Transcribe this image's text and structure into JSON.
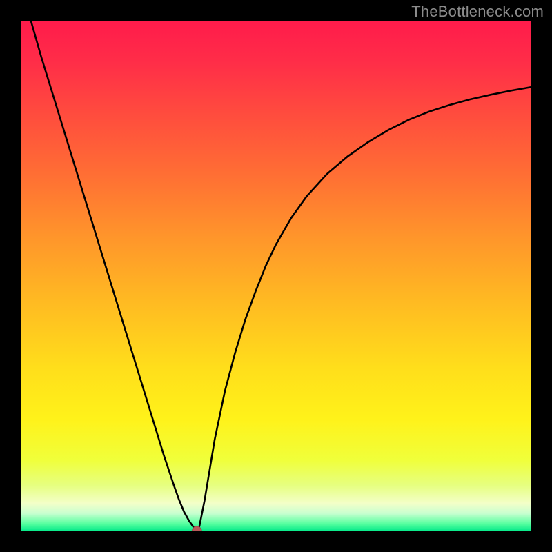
{
  "watermark": "TheBottleneck.com",
  "colors": {
    "frame": "#000000",
    "curve": "#000000",
    "marker_fill": "#b85a5a",
    "marker_stroke": "#a34d4d",
    "gradient_stops": [
      {
        "offset": 0.0,
        "color": "#ff1b4b"
      },
      {
        "offset": 0.08,
        "color": "#ff2d48"
      },
      {
        "offset": 0.18,
        "color": "#ff4b3e"
      },
      {
        "offset": 0.3,
        "color": "#ff6e34"
      },
      {
        "offset": 0.42,
        "color": "#ff942b"
      },
      {
        "offset": 0.55,
        "color": "#ffba22"
      },
      {
        "offset": 0.68,
        "color": "#ffde1b"
      },
      {
        "offset": 0.78,
        "color": "#fff21a"
      },
      {
        "offset": 0.86,
        "color": "#f0ff3a"
      },
      {
        "offset": 0.91,
        "color": "#e6ff80"
      },
      {
        "offset": 0.945,
        "color": "#f3ffc8"
      },
      {
        "offset": 0.965,
        "color": "#c8ffd0"
      },
      {
        "offset": 0.985,
        "color": "#58ffa0"
      },
      {
        "offset": 1.0,
        "color": "#00e888"
      }
    ]
  },
  "chart_data": {
    "type": "line",
    "title": "",
    "xlabel": "",
    "ylabel": "",
    "xlim": [
      0,
      100
    ],
    "ylim": [
      0,
      100
    ],
    "marker": {
      "x": 34.5,
      "y": 0
    },
    "series": [
      {
        "name": "bottleneck-curve",
        "x": [
          2,
          4,
          6,
          8,
          10,
          12,
          14,
          16,
          18,
          20,
          22,
          24,
          26,
          28,
          30,
          31,
          32,
          33,
          34,
          34.5,
          35,
          36,
          37,
          38,
          40,
          42,
          44,
          46,
          48,
          50,
          53,
          56,
          60,
          64,
          68,
          72,
          76,
          80,
          84,
          88,
          92,
          96,
          100
        ],
        "y": [
          100,
          93,
          86.5,
          80,
          73.5,
          67,
          60.5,
          54,
          47.5,
          41,
          34.5,
          28,
          21.5,
          15,
          9,
          6.2,
          3.8,
          2.0,
          0.6,
          0.0,
          1.0,
          6,
          12,
          18,
          27.5,
          35,
          41.5,
          47,
          52,
          56.2,
          61.4,
          65.6,
          70,
          73.4,
          76.2,
          78.6,
          80.6,
          82.2,
          83.5,
          84.6,
          85.5,
          86.3,
          87.0
        ]
      }
    ]
  }
}
